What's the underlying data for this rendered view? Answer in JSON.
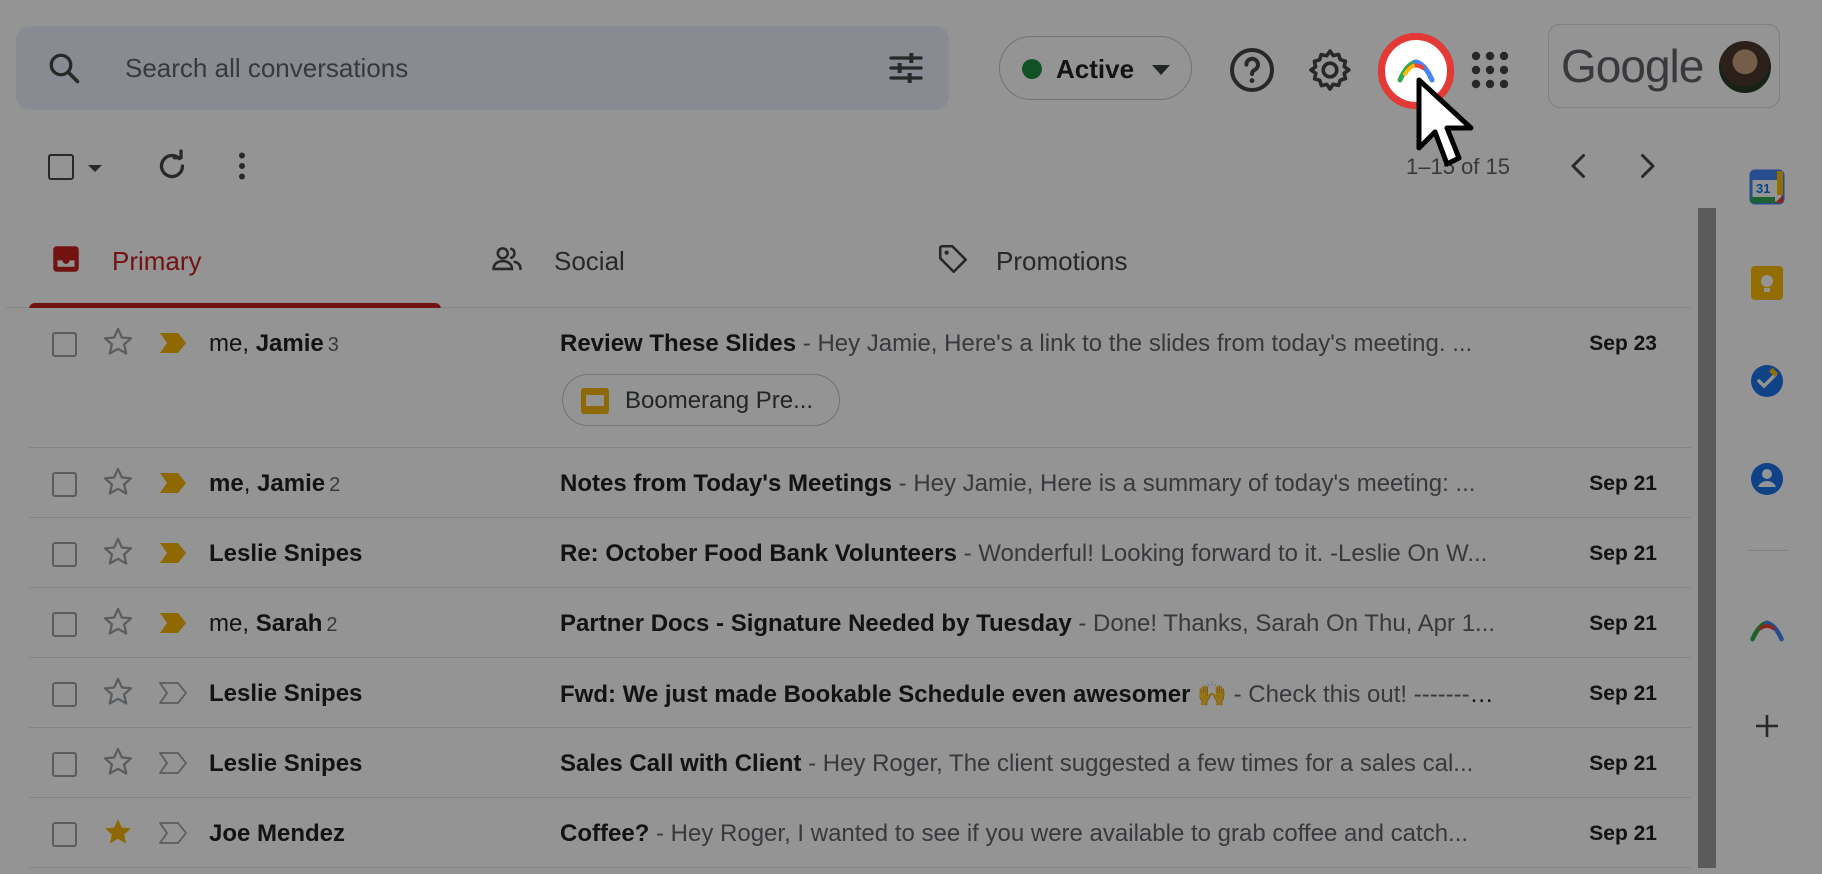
{
  "search": {
    "placeholder": "Search all conversations",
    "icon": "search-icon",
    "filter_icon": "tune-icon"
  },
  "status": {
    "label": "Active",
    "color": "#1e8e3e"
  },
  "header": {
    "help_icon": "help-icon",
    "settings_icon": "gear-icon",
    "boomerang_icon": "boomerang-icon",
    "apps_icon": "apps-grid-icon",
    "logo_text": "Google"
  },
  "toolbar": {
    "pagination": "1–15 of 15"
  },
  "tabs": [
    {
      "label": "Primary",
      "icon": "inbox-icon",
      "active": true
    },
    {
      "label": "Social",
      "icon": "people-icon",
      "active": false
    },
    {
      "label": "Promotions",
      "icon": "tag-icon",
      "active": false
    }
  ],
  "emails": [
    {
      "sender_parts": [
        [
          "me",
          false
        ],
        [
          ", ",
          false
        ],
        [
          "Jamie",
          true
        ]
      ],
      "count": "3",
      "subject": "Review These Slides",
      "snippet": " - Hey Jamie, Here's a link to the slides from today's meeting. ...",
      "date": "Sep 23",
      "important": true,
      "starred": false,
      "attachment": "Boomerang Pre..."
    },
    {
      "sender_parts": [
        [
          "me",
          true
        ],
        [
          ", ",
          false
        ],
        [
          "Jamie",
          true
        ]
      ],
      "count": "2",
      "subject": "Notes from Today's Meetings",
      "snippet": " - Hey Jamie, Here is a summary of today's meeting: ...",
      "date": "Sep 21",
      "important": true,
      "starred": false
    },
    {
      "sender_parts": [
        [
          "Leslie Snipes",
          true
        ]
      ],
      "count": "",
      "subject": "Re: October Food Bank Volunteers",
      "snippet": " - Wonderful! Looking forward to it. -Leslie On W...",
      "date": "Sep 21",
      "important": true,
      "starred": false
    },
    {
      "sender_parts": [
        [
          "me",
          false
        ],
        [
          ", ",
          false
        ],
        [
          "Sarah",
          true
        ]
      ],
      "count": "2",
      "subject": "Partner Docs - Signature Needed by Tuesday",
      "snippet": " - Done! Thanks, Sarah On Thu, Apr 1...",
      "date": "Sep 21",
      "important": true,
      "starred": false
    },
    {
      "sender_parts": [
        [
          "Leslie Snipes",
          true
        ]
      ],
      "count": "",
      "subject": "Fwd: We just made Bookable Schedule even awesomer 🙌",
      "snippet": " - Check this out! ----------...",
      "date": "Sep 21",
      "important": false,
      "starred": false
    },
    {
      "sender_parts": [
        [
          "Leslie Snipes",
          true
        ]
      ],
      "count": "",
      "subject": "Sales Call with Client",
      "snippet": " - Hey Roger, The client suggested a few times for a sales cal...",
      "date": "Sep 21",
      "important": false,
      "starred": false
    },
    {
      "sender_parts": [
        [
          "Joe Mendez",
          true
        ]
      ],
      "count": "",
      "subject": "Coffee?",
      "snippet": " - Hey Roger, I wanted to see if you were available to grab coffee and catch...",
      "date": "Sep 21",
      "important": false,
      "starred": true
    }
  ],
  "sidepanel": {
    "calendar_day": "31",
    "icons": [
      "calendar-icon",
      "keep-icon",
      "tasks-icon",
      "contacts-icon",
      "boomerang-icon",
      "add-icon"
    ]
  },
  "colors": {
    "accent": "#c5221f",
    "important": "#f4b400",
    "star": "#f4b400"
  }
}
